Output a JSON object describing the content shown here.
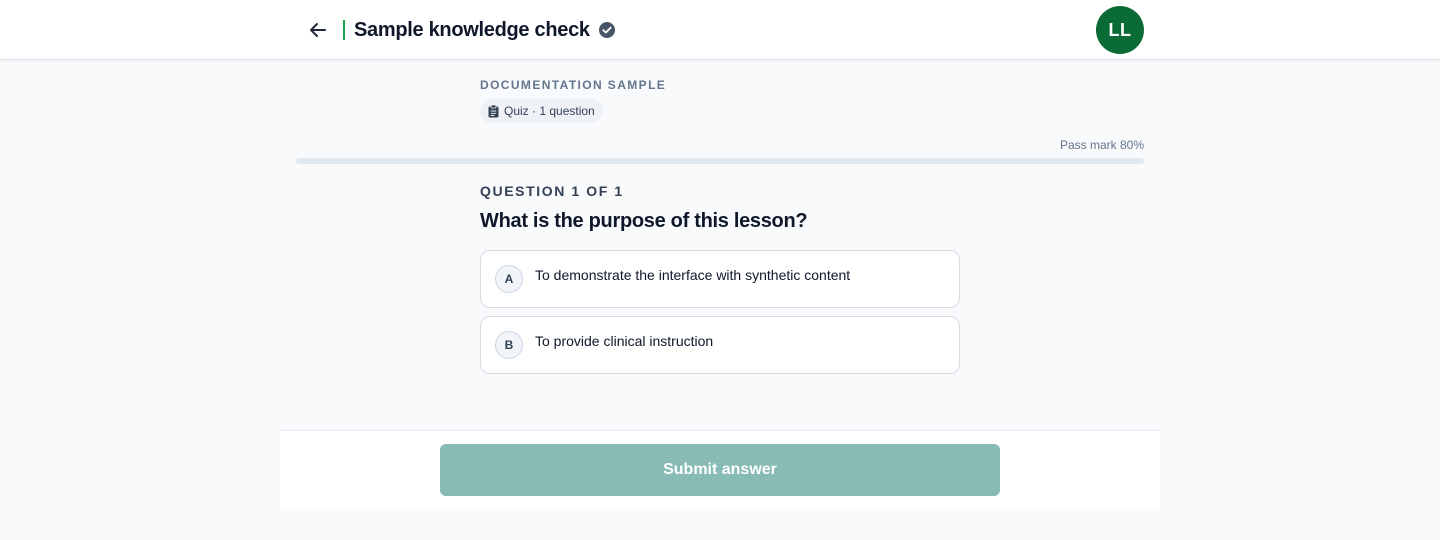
{
  "header": {
    "title": "Sample knowledge check",
    "back_icon": "arrow-left-icon",
    "status_icon": "check-circle-icon",
    "avatar_initials": "LL",
    "accent_color": "#16a34a",
    "avatar_color": "#0b6b36"
  },
  "quiz": {
    "eyebrow": "DOCUMENTATION SAMPLE",
    "chip_icon": "clipboard-icon",
    "chip_label": "Quiz · 1 question",
    "pass_mark": "Pass mark 80%",
    "progress_fraction": 0
  },
  "question": {
    "counter": "QUESTION 1 OF 1",
    "text": "What is the purpose of this lesson?",
    "options": [
      {
        "letter": "A",
        "text": "To demonstrate the interface with synthetic content"
      },
      {
        "letter": "B",
        "text": "To provide clinical instruction"
      }
    ]
  },
  "footer": {
    "submit_label": "Submit answer",
    "submit_enabled": false,
    "submit_color": "#88bbb6"
  }
}
